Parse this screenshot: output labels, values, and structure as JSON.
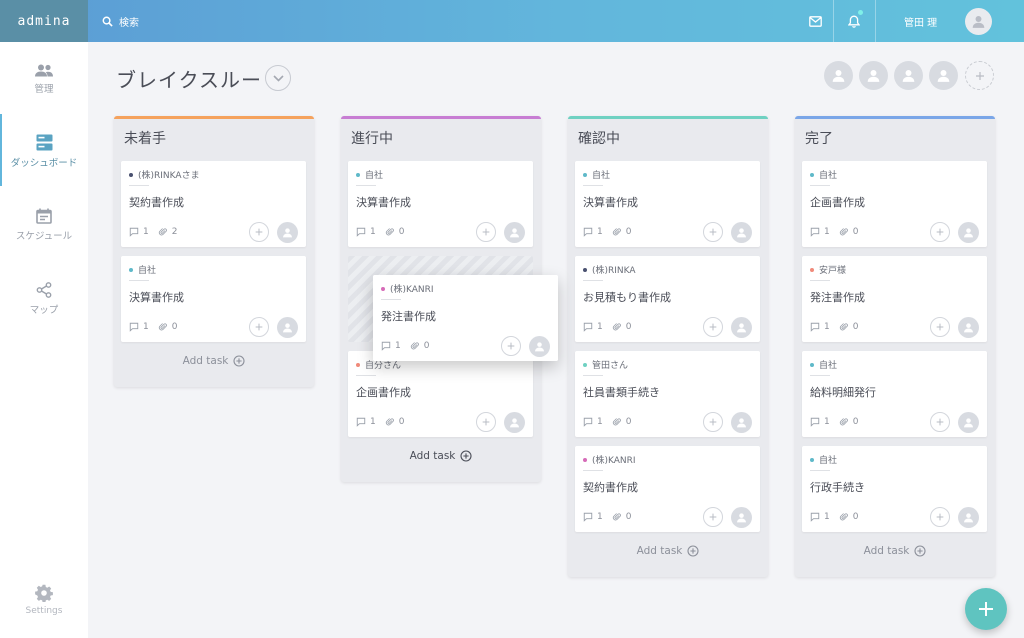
{
  "app": {
    "brand": "admina"
  },
  "topbar": {
    "search_label": "検索",
    "username": "管田 理",
    "colors": {
      "accent": "#62b6dc"
    }
  },
  "sidebar": {
    "items": [
      {
        "label": "管理",
        "icon": "people-icon"
      },
      {
        "label": "ダッシュボード",
        "icon": "dashboard-icon",
        "active": true
      },
      {
        "label": "スケジュール",
        "icon": "calendar-icon"
      },
      {
        "label": "マップ",
        "icon": "share-icon"
      }
    ],
    "settings_label": "Settings"
  },
  "board": {
    "title": "ブレイクスルー",
    "add_task_label": "Add task"
  },
  "columns": [
    {
      "title": "未着手",
      "color": "#f5a25d",
      "cards": [
        {
          "client": "(株)RINKAさま",
          "dot": "#4a5170",
          "task": "契約書作成",
          "comments": "1",
          "attachments": "2"
        },
        {
          "client": "自社",
          "dot": "#5fb9c9",
          "task": "決算書作成",
          "comments": "1",
          "attachments": "0"
        }
      ]
    },
    {
      "title": "進行中",
      "color": "#c77dd3",
      "cards": [
        {
          "client": "自社",
          "dot": "#5fb9c9",
          "task": "決算書作成",
          "comments": "1",
          "attachments": "0"
        },
        {
          "client": "自分さん",
          "dot": "#f08a7a",
          "task": "企画書作成",
          "comments": "1",
          "attachments": "0"
        }
      ]
    },
    {
      "title": "確認中",
      "color": "#6fd1c2",
      "cards": [
        {
          "client": "自社",
          "dot": "#5fb9c9",
          "task": "決算書作成",
          "comments": "1",
          "attachments": "0"
        },
        {
          "client": "(株)RINKA",
          "dot": "#4a5170",
          "task": "お見積もり書作成",
          "comments": "1",
          "attachments": "0"
        },
        {
          "client": "管田さん",
          "dot": "#6fd1c2",
          "task": "社員書類手続き",
          "comments": "1",
          "attachments": "0"
        },
        {
          "client": "(株)KANRI",
          "dot": "#d66bb8",
          "task": "契約書作成",
          "comments": "1",
          "attachments": "0"
        }
      ]
    },
    {
      "title": "完了",
      "color": "#7aa6e8",
      "cards": [
        {
          "client": "自社",
          "dot": "#5fb9c9",
          "task": "企画書作成",
          "comments": "1",
          "attachments": "0"
        },
        {
          "client": "安戸様",
          "dot": "#f08a7a",
          "task": "発注書作成",
          "comments": "1",
          "attachments": "0"
        },
        {
          "client": "自社",
          "dot": "#5fb9c9",
          "task": "給料明細発行",
          "comments": "1",
          "attachments": "0"
        },
        {
          "client": "自社",
          "dot": "#5fb9c9",
          "task": "行政手続き",
          "comments": "1",
          "attachments": "0"
        }
      ]
    }
  ],
  "dragging_card": {
    "client": "(株)KANRI",
    "dot": "#d66bb8",
    "task": "発注書作成",
    "comments": "1",
    "attachments": "0"
  }
}
